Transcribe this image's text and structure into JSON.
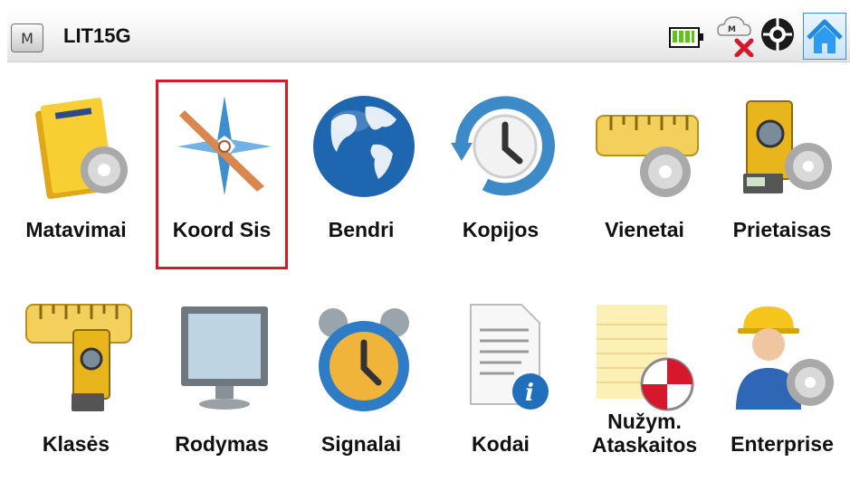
{
  "header": {
    "menu_glyph": "M",
    "job_name": "LIT15G",
    "icons": [
      "battery-icon",
      "cloud-disconnected-icon",
      "connection-globe-icon",
      "home-icon"
    ]
  },
  "tiles_row1": [
    {
      "id": "matavimai",
      "label": "Matavimai",
      "icon": "folder-gear-icon"
    },
    {
      "id": "koord-sis",
      "label": "Koord Sis",
      "icon": "compass-icon",
      "selected": true
    },
    {
      "id": "bendri",
      "label": "Bendri",
      "icon": "globe-icon"
    },
    {
      "id": "kopijos",
      "label": "Kopijos",
      "icon": "backup-clock-icon"
    },
    {
      "id": "vienetai",
      "label": "Vienetai",
      "icon": "ruler-gear-icon"
    },
    {
      "id": "prietaisas",
      "label": "Prietaisas",
      "icon": "total-station-gear-icon"
    }
  ],
  "tiles_row2": [
    {
      "id": "klases",
      "label": "Klasės",
      "icon": "ruler-instrument-icon"
    },
    {
      "id": "rodymas",
      "label": "Rodymas",
      "icon": "monitor-icon"
    },
    {
      "id": "signalai",
      "label": "Signalai",
      "icon": "alarm-clock-icon"
    },
    {
      "id": "kodai",
      "label": "Kodai",
      "icon": "document-info-icon"
    },
    {
      "id": "nuzym",
      "label_line1": "Nužym.",
      "label_line2": "Ataskaitos",
      "icon": "notepad-target-icon"
    },
    {
      "id": "enterprise",
      "label": "Enterprise",
      "icon": "worker-gear-icon"
    }
  ],
  "colors": {
    "selection": "#d7172c",
    "header_bg": "#ececec",
    "battery": "#5bc51c"
  }
}
